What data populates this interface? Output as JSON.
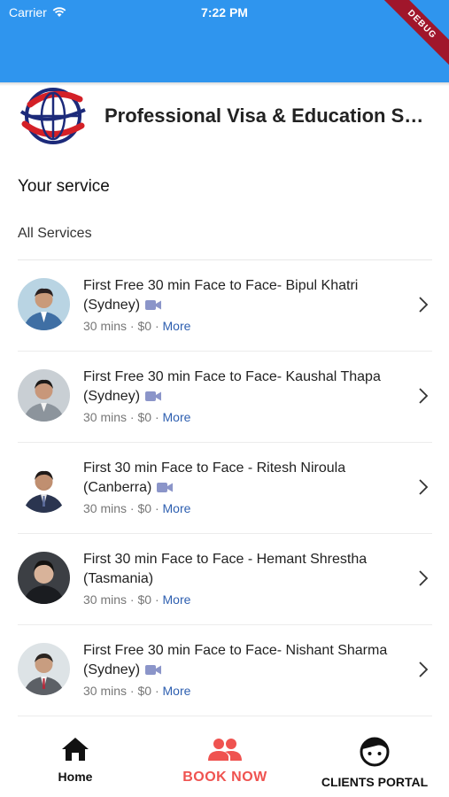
{
  "status_bar": {
    "carrier": "Carrier",
    "time": "7:22 PM",
    "debug_label": "DEBUG",
    "background": "#2f95ee"
  },
  "brand": {
    "name": "Professional Visa & Education Services",
    "logo_icon": "globe-logo-icon"
  },
  "section": {
    "title": "Your service",
    "subtitle": "All Services"
  },
  "services": [
    {
      "title": "First Free 30 min Face to Face- Bipul Khatri (Sydney)",
      "duration": "30 mins",
      "price": "$0",
      "more": "More",
      "icon": "video-icon"
    },
    {
      "title": "First Free 30 min Face to Face- Kaushal Thapa (Sydney)",
      "duration": "30 mins",
      "price": "$0",
      "more": "More",
      "icon": "video-icon"
    },
    {
      "title": "First 30 min Face to Face - Ritesh Niroula (Canberra)",
      "duration": "30 mins",
      "price": "$0",
      "more": "More",
      "icon": "video-icon"
    },
    {
      "title": "First 30 min Face to Face - Hemant Shrestha (Tasmania)",
      "duration": "30 mins",
      "price": "$0",
      "more": "More",
      "icon": "none"
    },
    {
      "title": "First Free 30 min Face to Face- Nishant Sharma (Sydney)",
      "duration": "30 mins",
      "price": "$0",
      "more": "More",
      "icon": "video-icon"
    }
  ],
  "meta_separator": "·",
  "bottom_nav": {
    "home": "Home",
    "book": "BOOK NOW",
    "portal": "CLIENTS PORTAL"
  },
  "colors": {
    "accent_red": "#ef5350",
    "link_blue": "#2e5fb0",
    "video_icon": "#8b95c9"
  }
}
